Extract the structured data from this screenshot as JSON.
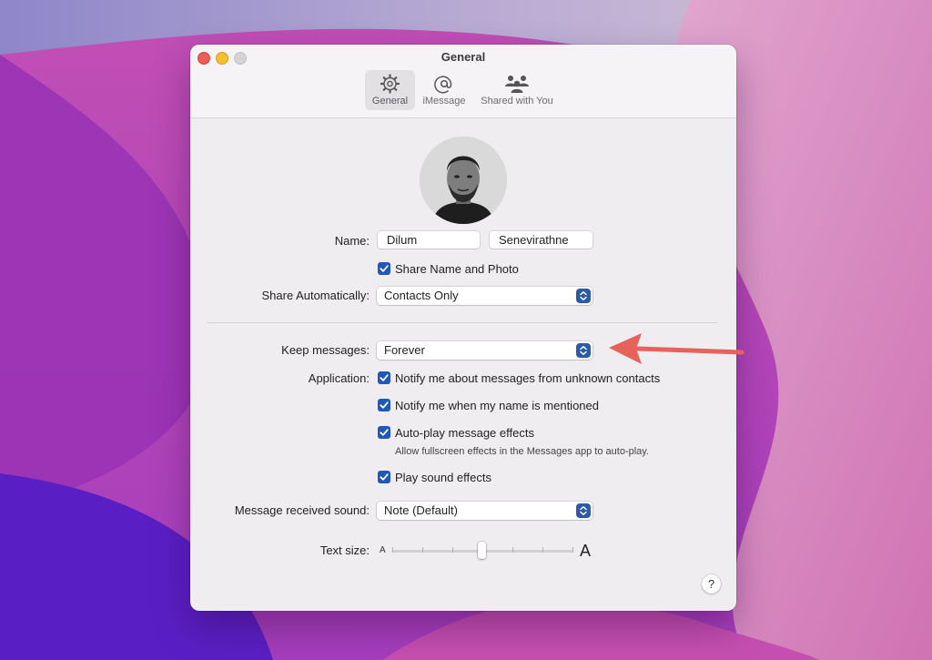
{
  "window": {
    "title": "General"
  },
  "tabs": [
    {
      "label": "General",
      "icon": "gear-icon",
      "active": true
    },
    {
      "label": "iMessage",
      "icon": "at-sign-icon",
      "active": false
    },
    {
      "label": "Shared with You",
      "icon": "people-icon",
      "active": false
    }
  ],
  "name": {
    "label": "Name:",
    "first": "Dilum",
    "last": "Senevirathne"
  },
  "share_name_photo": {
    "label": "Share Name and Photo",
    "checked": true
  },
  "share_auto": {
    "label": "Share Automatically:",
    "value": "Contacts Only"
  },
  "keep_messages": {
    "label": "Keep messages:",
    "value": "Forever"
  },
  "application": {
    "label": "Application:",
    "options": [
      {
        "label": "Notify me about messages from unknown contacts",
        "checked": true
      },
      {
        "label": "Notify me when my name is mentioned",
        "checked": true
      },
      {
        "label": "Auto-play message effects",
        "checked": true,
        "sub": "Allow fullscreen effects in the Messages app to auto-play."
      },
      {
        "label": "Play sound effects",
        "checked": true
      }
    ]
  },
  "sound": {
    "label": "Message received sound:",
    "value": "Note (Default)"
  },
  "text_size": {
    "label": "Text size:",
    "small": "A",
    "large": "A",
    "level": 0.5
  },
  "help": {
    "label": "?"
  },
  "colors": {
    "accent": "#1f58b8",
    "arrow": "#e5635a"
  }
}
